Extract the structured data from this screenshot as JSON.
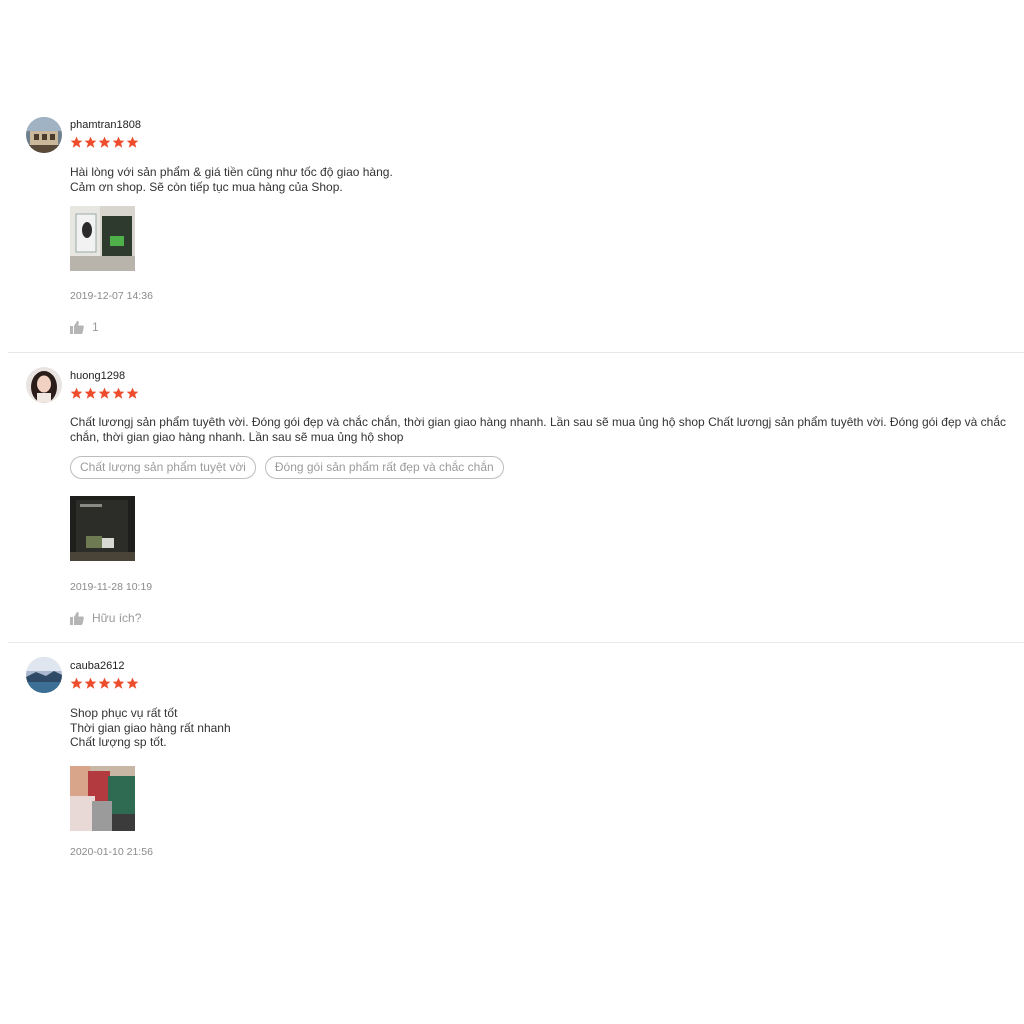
{
  "reviews": [
    {
      "username": "phamtran1808",
      "rating": 5,
      "comment_lines": [
        "Hài lòng với sản phẩm & giá tiền cũng như tốc độ giao hàng.",
        "Cảm ơn shop. Sẽ còn tiếp tục mua hàng của Shop."
      ],
      "tags": [],
      "date": "2019-12-07 14:36",
      "like_label": "1"
    },
    {
      "username": "huong1298",
      "rating": 5,
      "comment_lines": [
        "Chất lươngj sản phẩm tuyêth vời. Đóng gói đẹp và chắc chắn, thời gian giao hàng nhanh. Lần sau sẽ mua ủng hộ shop Chất lươngj sản phẩm tuyêth vời. Đóng gói đẹp và chắc chắn, thời gian giao hàng nhanh. Lần sau sẽ mua ủng hộ shop"
      ],
      "tags": [
        "Chất lượng sản phẩm tuyệt vời",
        "Đóng gói sản phẩm rất đẹp và chắc chắn"
      ],
      "date": "2019-11-28 10:19",
      "like_label": "Hữu ích?"
    },
    {
      "username": "cauba2612",
      "rating": 5,
      "comment_lines": [
        "Shop phục vụ rất tốt",
        "Thời gian giao hàng rất nhanh",
        "Chất lượng sp tốt."
      ],
      "tags": [],
      "date": "2020-01-10 21:56",
      "like_label": ""
    }
  ],
  "colors": {
    "star": "#ee4d2d",
    "divider": "#e8e8e8",
    "muted": "#8a8a8a"
  },
  "icons": {
    "rating": "star-icon",
    "like": "thumbs-up-icon"
  }
}
